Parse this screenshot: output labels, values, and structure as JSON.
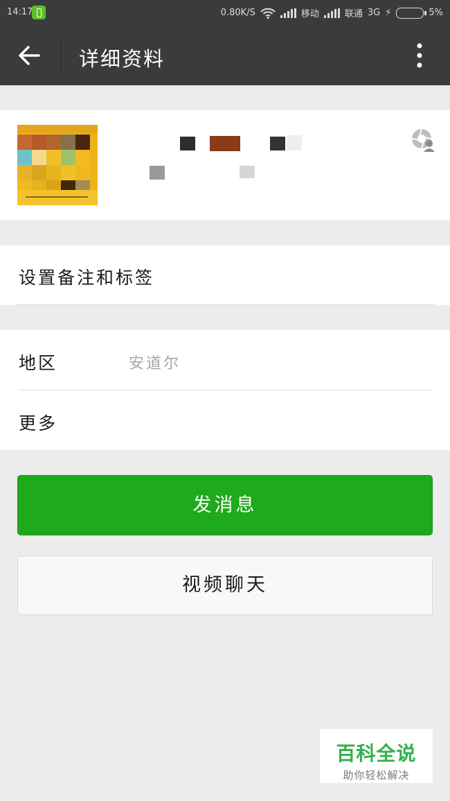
{
  "status_bar": {
    "time": "14:17",
    "net_speed": "0.80K/S",
    "carrier1": "移动",
    "carrier2": "联通",
    "network_type": "3G",
    "battery": "5%"
  },
  "header": {
    "title": "详细资料",
    "back_icon": "arrow-left-icon",
    "menu_icon": "more-vertical-icon"
  },
  "profile": {
    "avatar_icon": "avatar-image",
    "moments_icon": "moments-camera-icon"
  },
  "remark": {
    "label": "设置备注和标签"
  },
  "info": {
    "region_label": "地区",
    "region_value": "安道尔",
    "more_label": "更多"
  },
  "actions": {
    "send_message": "发消息",
    "video_chat": "视频聊天"
  },
  "watermark": {
    "title": "百科全说",
    "subtitle": "助你轻松解决"
  },
  "colors": {
    "header_bg": "#3b3b3b",
    "primary_green": "#1faa1d",
    "page_bg": "#ececec"
  }
}
